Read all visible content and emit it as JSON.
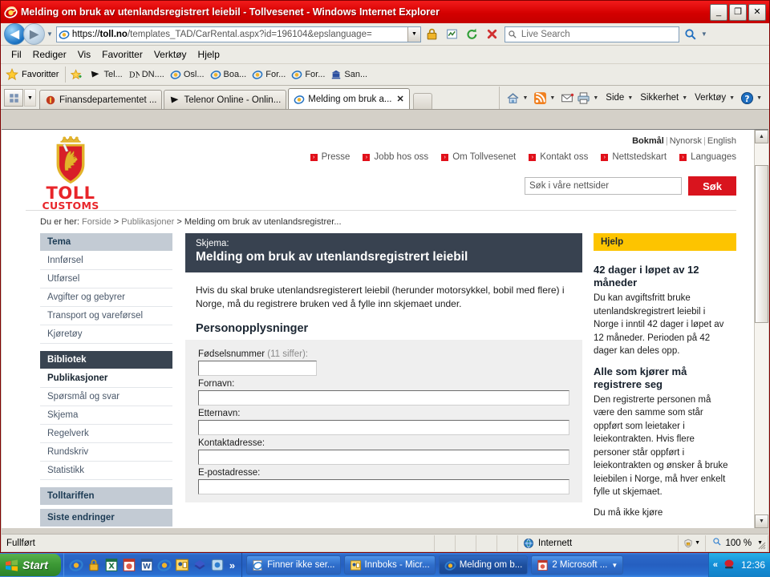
{
  "window": {
    "title": "Melding om bruk av utenlandsregistrert leiebil - Tollvesenet - Windows Internet Explorer",
    "minimize_label": "_",
    "maximize_label": "❐",
    "close_label": "✕"
  },
  "address_bar": {
    "url_scheme": "https://",
    "url_host": "toll.no",
    "url_path": "/templates_TAD/CarRental.aspx?id=196104&epslanguage=",
    "search_placeholder": "Live Search",
    "icons": {
      "back": "back-arrow-icon",
      "forward": "forward-arrow-icon",
      "history_caret": "chevron-down-icon",
      "lock": "padlock-icon",
      "compat": "compatibility-view-icon",
      "refresh": "refresh-icon",
      "stop": "stop-icon",
      "search": "search-icon"
    }
  },
  "menubar": {
    "items": [
      "Fil",
      "Rediger",
      "Vis",
      "Favoritter",
      "Verktøy",
      "Hjelp"
    ]
  },
  "favbar": {
    "favorites_label": "Favoritter",
    "items": [
      "Tel...",
      "DN....",
      "Osl...",
      "Boa...",
      "For...",
      "For...",
      "San..."
    ]
  },
  "tabs": [
    {
      "label": "Finansdepartementet ...",
      "active": false
    },
    {
      "label": "Telenor Online - Onlin...",
      "active": false
    },
    {
      "label": "Melding om bruk a...",
      "active": true,
      "close_label": "✕"
    }
  ],
  "commandbar": {
    "items": [
      "Side",
      "Sikkerhet",
      "Verktøy"
    ],
    "icons": [
      "home-icon",
      "feeds-icon",
      "mail-icon",
      "print-icon",
      "help-icon"
    ]
  },
  "site": {
    "logo": {
      "line1": "TOLL",
      "line2": "CUSTOMS"
    },
    "languages": {
      "current": "Bokmål",
      "alt1": "Nynorsk",
      "alt2": "English",
      "separator": "|"
    },
    "toplinks": [
      "Presse",
      "Jobb hos oss",
      "Om Tollvesenet",
      "Kontakt oss",
      "Nettstedskart",
      "Languages"
    ],
    "search": {
      "placeholder": "Søk i våre nettsider",
      "button": "Søk"
    },
    "breadcrumb": {
      "prefix": "Du er her:",
      "items": [
        "Forside",
        "Publikasjoner",
        "Melding om bruk av utenlandsregistrer..."
      ],
      "separator": ">"
    }
  },
  "leftnav": {
    "groups": [
      {
        "header": "Tema",
        "dark": false,
        "items": [
          {
            "label": "Innførsel",
            "selected": false
          },
          {
            "label": "Utførsel",
            "selected": false
          },
          {
            "label": "Avgifter og gebyrer",
            "selected": false
          },
          {
            "label": "Transport og vareførsel",
            "selected": false
          },
          {
            "label": "Kjøretøy",
            "selected": false
          }
        ]
      },
      {
        "header": "Bibliotek",
        "dark": true,
        "items": [
          {
            "label": "Publikasjoner",
            "selected": true
          },
          {
            "label": "Spørsmål og svar",
            "selected": false
          },
          {
            "label": "Skjema",
            "selected": false
          },
          {
            "label": "Regelverk",
            "selected": false
          },
          {
            "label": "Rundskriv",
            "selected": false
          },
          {
            "label": "Statistikk",
            "selected": false
          }
        ]
      },
      {
        "header": "Tolltariffen",
        "dark": false,
        "items": []
      },
      {
        "header": "Siste endringer",
        "dark": false,
        "items": []
      }
    ]
  },
  "form": {
    "kicker": "Skjema:",
    "title": "Melding om bruk av utenlandsregistrert leiebil",
    "intro": "Hvis du skal bruke utenlandsregisterert leiebil (herunder motorsykkel, bobil med flere) i Norge, må du registrere bruken ved å fylle inn skjemaet under.",
    "section_title": "Personopplysninger",
    "fields": [
      {
        "label": "Fødselsnummer",
        "hint": "(11 siffer):",
        "value": "",
        "short": true
      },
      {
        "label": "Fornavn:",
        "hint": "",
        "value": "",
        "short": false
      },
      {
        "label": "Etternavn:",
        "hint": "",
        "value": "",
        "short": false
      },
      {
        "label": "Kontaktadresse:",
        "hint": "",
        "value": "",
        "short": false
      },
      {
        "label": "E-postadresse:",
        "hint": "",
        "value": "",
        "short": false
      }
    ]
  },
  "help": {
    "header": "Hjelp",
    "blocks": [
      {
        "title": "42 dager i løpet av 12 måneder",
        "text": "Du kan avgiftsfritt bruke utenlandskregistrert leiebil i Norge i inntil 42 dager i løpet av 12 måneder. Perioden på 42 dager kan deles opp."
      },
      {
        "title": "Alle som kjører må registrere seg",
        "text": "Den registrerte personen må være den samme som står oppført som leietaker i leiekontrakten. Hvis flere personer står oppført i leiekontrakten og ønsker å bruke leiebilen i Norge, må hver enkelt fylle ut skjemaet."
      },
      {
        "title": "",
        "text": "Du må ikke kjøre"
      }
    ]
  },
  "statusbar": {
    "status": "Fullført",
    "zone": "Internett",
    "zoom": "100 %",
    "zoom_caret": "▼",
    "protected_icon": "protected-mode-icon"
  },
  "taskbar": {
    "start": "Start",
    "quicklaunch_overflow": "»",
    "tasks": [
      {
        "label": "Finner ikke ser...",
        "active": false
      },
      {
        "label": "Innboks - Micr...",
        "active": false
      },
      {
        "label": "Melding om b...",
        "active": true
      },
      {
        "label": "2 Microsoft ...",
        "active": false,
        "caret": "▼"
      }
    ],
    "tray_chevron": "«",
    "clock": "12:36"
  },
  "colors": {
    "title_red": "#d40000",
    "brand_red": "#e8252a",
    "help_yellow": "#fdc400",
    "nav_dark": "#394451",
    "nav_light": "#c3cbd4",
    "form_header": "#384250"
  }
}
